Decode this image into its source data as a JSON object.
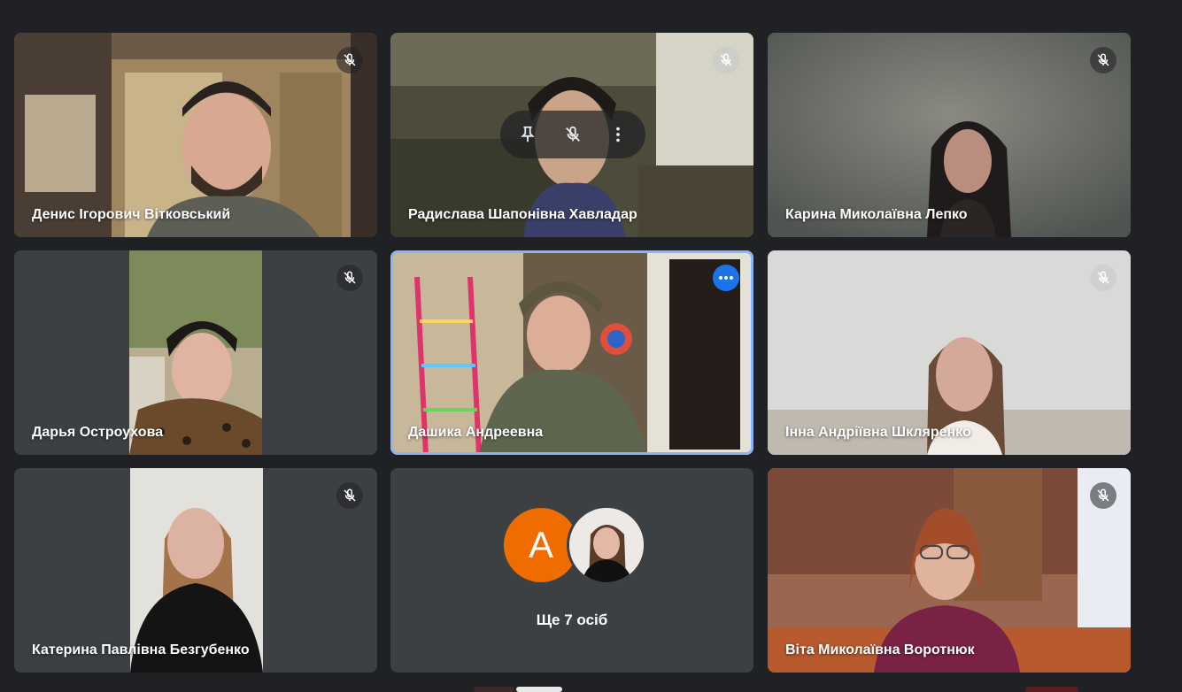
{
  "participants": [
    {
      "name": "Денис Ігорович Вітковський",
      "muted": true
    },
    {
      "name": "Радислава Шапонівна Хавладар",
      "muted": true
    },
    {
      "name": "Карина Миколаївна Лепко",
      "muted": true
    },
    {
      "name": "Дарья Остроухова",
      "muted": true
    },
    {
      "name": "Дашика Андреевна",
      "muted": false,
      "active_speaker": true
    },
    {
      "name": "Інна Андріївна Шкляренко",
      "muted": true
    },
    {
      "name": "Катерина Павлівна Безгубенко",
      "muted": true
    },
    {
      "name": "Віта Миколаївна Воротнюк",
      "muted": true
    }
  ],
  "others_tile": {
    "avatar_letter": "A",
    "label": "Ще 7 осіб"
  },
  "icons": {
    "muted": "mic-off-icon",
    "pin": "pin-icon",
    "more": "more-options-icon"
  },
  "colors": {
    "background": "#202124",
    "tile": "#3c4043",
    "active_border": "#8ab4f8",
    "avatar_a": "#ef6c00",
    "more_button": "#1a73e8"
  }
}
